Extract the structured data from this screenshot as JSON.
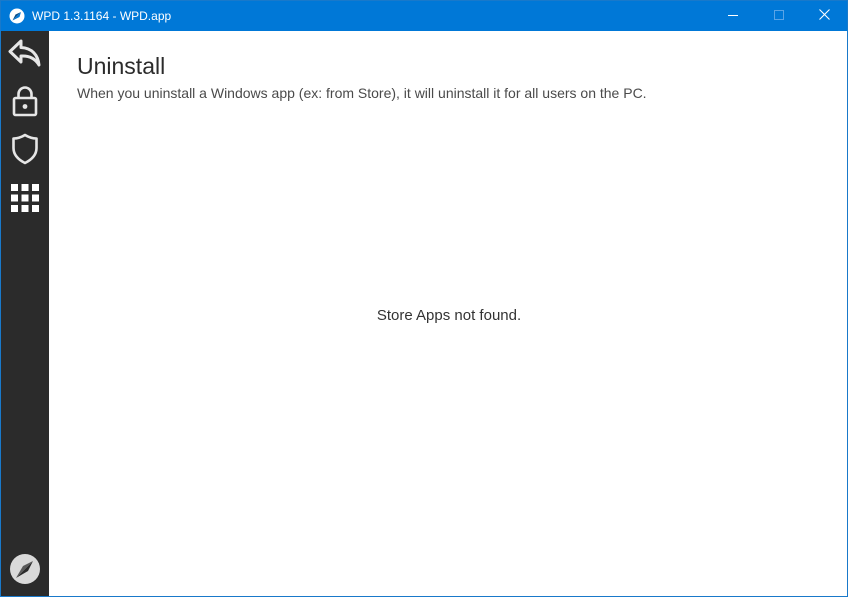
{
  "window": {
    "title": "WPD 1.3.1164 - WPD.app",
    "app_icon": "wpd-logo-icon",
    "controls": {
      "minimize_icon": "minimize-icon",
      "maximize_icon": "maximize-icon",
      "close_icon": "close-icon"
    }
  },
  "sidebar": {
    "items": [
      {
        "id": "back",
        "icon": "back-arrow-icon"
      },
      {
        "id": "privacy",
        "icon": "lock-icon"
      },
      {
        "id": "security",
        "icon": "shield-icon"
      },
      {
        "id": "apps",
        "icon": "apps-grid-icon",
        "selected": true
      },
      {
        "id": "about",
        "icon": "compass-icon"
      }
    ]
  },
  "main": {
    "title": "Uninstall",
    "subtitle": "When you uninstall a Windows app (ex: from Store), it will uninstall it for all users on the PC.",
    "empty_message": "Store Apps not found."
  },
  "colors": {
    "titlebar": "#0078d7",
    "sidebar": "#2b2b2b",
    "background": "#ffffff",
    "icon": "#e6e6e6"
  }
}
